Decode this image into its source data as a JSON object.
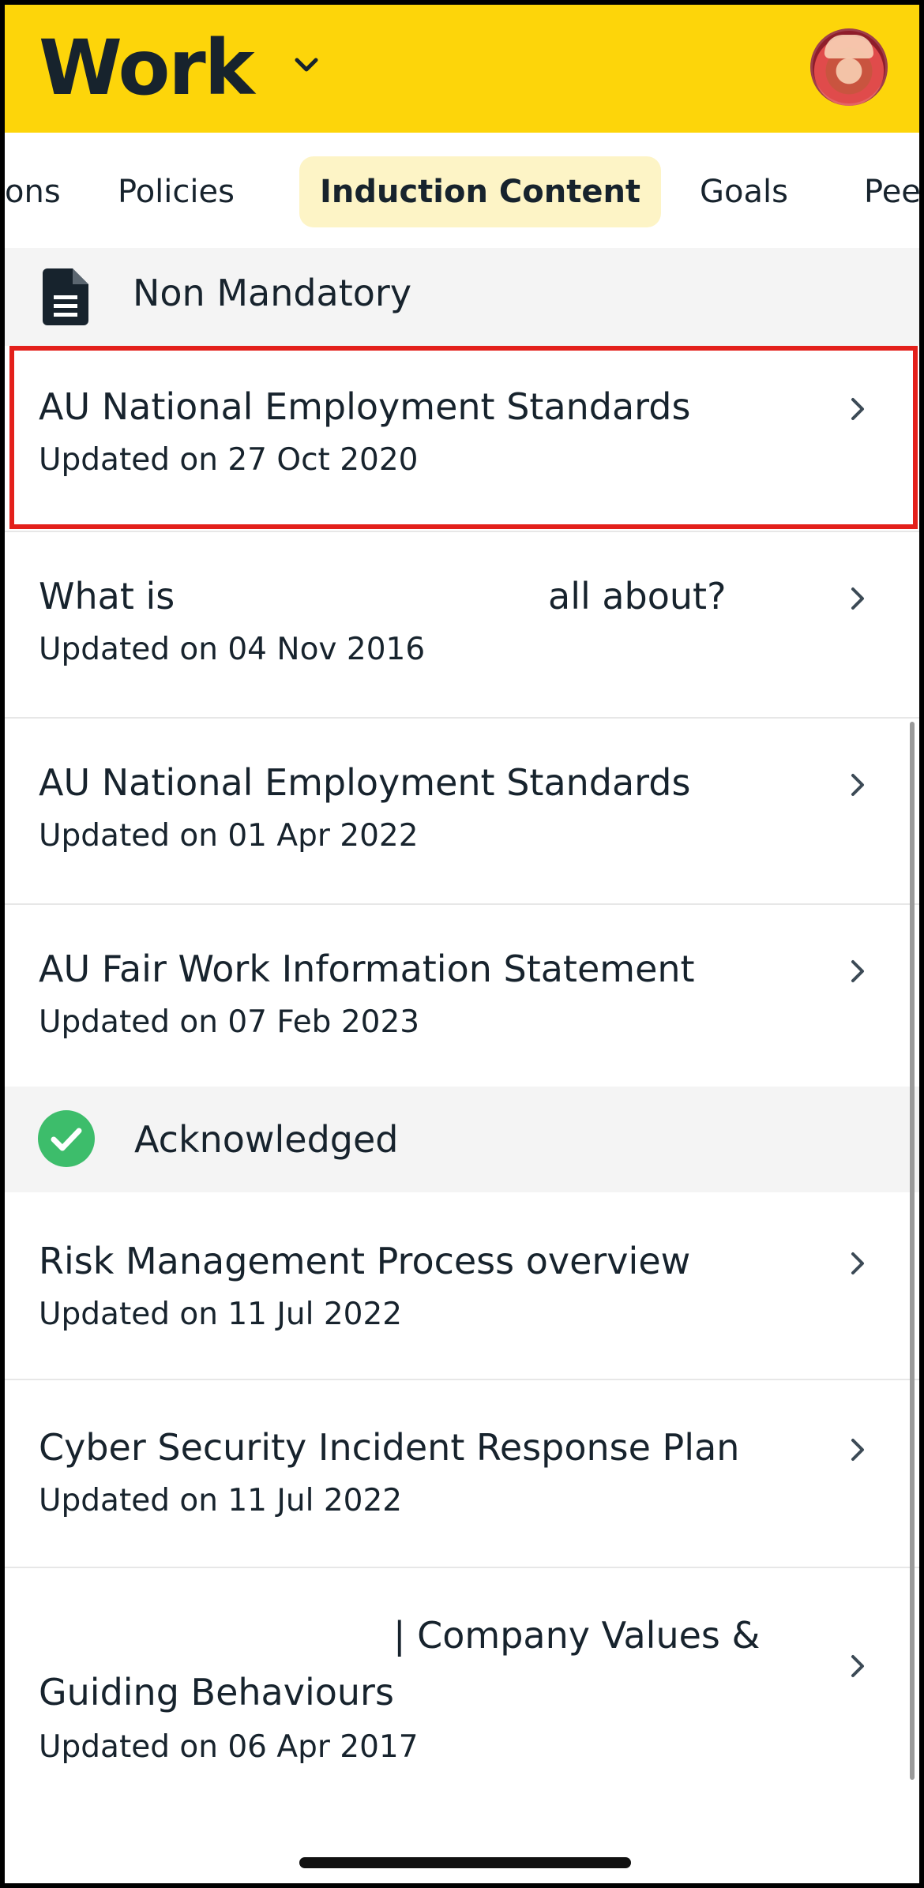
{
  "header": {
    "title": "Work",
    "accent_color": "#fdd50a"
  },
  "tabs": [
    {
      "label": "ons"
    },
    {
      "label": "Policies"
    },
    {
      "label": "Induction Content",
      "active": true
    },
    {
      "label": "Goals"
    },
    {
      "label": "Pee"
    }
  ],
  "sections": {
    "non_mandatory": {
      "label": "Non Mandatory",
      "icon": "document-icon"
    },
    "acknowledged": {
      "label": "Acknowledged",
      "icon": "check-circle-icon",
      "color": "#3dbd6b"
    }
  },
  "items": [
    {
      "title": "AU National Employment Standards",
      "date": "Updated on 27 Oct 2020"
    },
    {
      "title_left": "What is",
      "title_right": "all about?",
      "date": "Updated on 04 Nov 2016"
    },
    {
      "title": "AU National Employment Standards",
      "date": "Updated on 01 Apr 2022"
    },
    {
      "title": "AU Fair Work Information Statement",
      "date": "Updated on 07 Feb 2023"
    },
    {
      "title": "Risk Management Process overview",
      "date": "Updated on 11 Jul 2022"
    },
    {
      "title": "Cyber Security Incident Response Plan",
      "date": "Updated on 11 Jul 2022"
    },
    {
      "title_line1": "| Company Values &",
      "title_line2": "Guiding Behaviours",
      "date": "Updated on 06 Apr 2017"
    }
  ],
  "highlight_color": "#e3201b"
}
